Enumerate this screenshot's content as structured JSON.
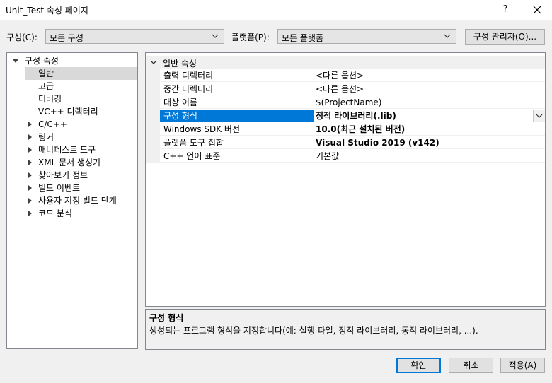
{
  "window": {
    "title": "Unit_Test 속성 페이지",
    "help": "?",
    "close": "✕"
  },
  "toolbar": {
    "config_label": "구성(C):",
    "config_value": "모든 구성",
    "platform_label": "플랫폼(P):",
    "platform_value": "모든 플랫폼",
    "config_manager": "구성 관리자(O)..."
  },
  "tree": {
    "root": "구성 속성",
    "items": [
      {
        "label": "일반",
        "selected": true,
        "expandable": false
      },
      {
        "label": "고급",
        "expandable": false
      },
      {
        "label": "디버깅",
        "expandable": false
      },
      {
        "label": "VC++ 디렉터리",
        "expandable": false
      },
      {
        "label": "C/C++",
        "expandable": true
      },
      {
        "label": "링커",
        "expandable": true
      },
      {
        "label": "매니페스트 도구",
        "expandable": true
      },
      {
        "label": "XML 문서 생성기",
        "expandable": true
      },
      {
        "label": "찾아보기 정보",
        "expandable": true
      },
      {
        "label": "빌드 이벤트",
        "expandable": true
      },
      {
        "label": "사용자 지정 빌드 단계",
        "expandable": true
      },
      {
        "label": "코드 분석",
        "expandable": true
      }
    ]
  },
  "grid": {
    "category": "일반 속성",
    "rows": [
      {
        "name": "출력 디렉터리",
        "value": "<다른 옵션>",
        "bold": false
      },
      {
        "name": "중간 디렉터리",
        "value": "<다른 옵션>",
        "bold": false
      },
      {
        "name": "대상 이름",
        "value": "$(ProjectName)",
        "bold": false
      },
      {
        "name": "구성 형식",
        "value": "정적 라이브러리(.lib)",
        "bold": true,
        "selected": true
      },
      {
        "name": "Windows SDK 버전",
        "value": "10.0(최근 설치된 버전)",
        "bold": true
      },
      {
        "name": "플랫폼 도구 집합",
        "value": "Visual Studio 2019 (v142)",
        "bold": true
      },
      {
        "name": "C++ 언어 표준",
        "value": "기본값",
        "bold": false
      }
    ]
  },
  "description": {
    "title": "구성 형식",
    "text": "생성되는 프로그램 형식을 지정합니다(예: 실행 파일, 정적 라이브러리, 동적 라이브러리, ...)."
  },
  "buttons": {
    "ok": "확인",
    "cancel": "취소",
    "apply": "적용(A)"
  },
  "colors": {
    "selection": "#0078d7",
    "tree_selection": "#d9d9d9"
  }
}
